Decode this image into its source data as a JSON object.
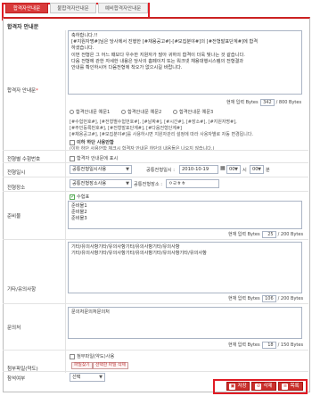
{
  "tabs": [
    {
      "label": "합격자안내문"
    },
    {
      "label": "불합격자안내문"
    },
    {
      "label": "예비합격자안내문"
    }
  ],
  "notice": {
    "section_title": "합격자 안내문",
    "label": "합격자 안내문",
    "required_mark": "*",
    "text_lines": [
      "축하합니다.!!",
      "[#지원자명#]님은 당사에서 진행한 [#채용공고#]-[#모집분야#]의 [#전형발표단계#]에 합격",
      "하셨습니다.",
      "이번 전형은 그 어느 때보다 우수한 지원자가 많아 귀하의 합격이 더욱 빛나는 것 같습니다.",
      "다음 전형에 관한 자세한 내용은 당사의 홈페이지 또는 워크넷 채용대행시스템의 전형결과",
      "안내를 확인하시어 다음전형에 착오가 없으시길 바랍니다."
    ],
    "bytes_label": "현재 입력 Bytes",
    "bytes_current": "342",
    "bytes_max": "/ 800 Bytes",
    "radio_options": [
      "합격안내문 예문1",
      "합격안내문 예문2",
      "합격안내문 예문3"
    ],
    "tags_line1": "[#수험번호#], [#전형별수험번호#], [#날짜#], [#시간#], [#장소#], [#지원자명#],",
    "tags_line2": "[#주민등록번호#], [#전형발표단계#], [#다음전형단계#]",
    "tags_line3": "[#채용공고#], [#모집분야#]를 사용하시면 지원자관리 설정에 따라 사용자별로 자동 변경됩니다.",
    "check_label": "이하 하단 사용안함",
    "check_note": "(이하 하단 사용안함 체크시 합격자 안내문 하단의 내용들은 나오지 않습니다.)"
  },
  "exam_number": {
    "label": "전형별 수험번호",
    "check_label": "합격자 안내문에 표시"
  },
  "schedule": {
    "label": "전형일시",
    "select_value": "공통전형일시사용",
    "date_label": "공통전형일시 :",
    "date_value": "2010-10-19",
    "hour_value": "00",
    "hour_unit": "시",
    "minute_value": "00",
    "minute_unit": "분"
  },
  "place": {
    "label": "전형장소",
    "select_value": "공통전형장소사용",
    "place_label": "공통전형장소 :",
    "place_value": "ㅇㄹㅎㅎ"
  },
  "supplies": {
    "label": "준비물",
    "check_label": "수험표",
    "lines": [
      "준비물1",
      "준비물2",
      "준비물3"
    ],
    "bytes_label": "현재 입력 Bytes",
    "bytes_current": "25",
    "bytes_max": "/ 200 Bytes"
  },
  "other": {
    "label": "기타/유의사항",
    "lines": [
      "기타/유의사항기타/유의사항기타/유의사항기타/유의사항",
      "기타/유의사항기타/유의사항기타/유의사항기타/유의사항기타/유의사항"
    ],
    "bytes_label": "현재 입력 Bytes",
    "bytes_current": "106",
    "bytes_max": "/ 200 Bytes"
  },
  "contact": {
    "label": "문의처",
    "lines": [
      "문의처문의처문의처"
    ],
    "bytes_label": "현재 입력 Bytes",
    "bytes_current": "18",
    "bytes_max": "/ 150 Bytes"
  },
  "attachment": {
    "label": "첨부파일(약도)",
    "check_label": "첨부파일(약도)사용",
    "btn_find": "파일찾기",
    "btn_delete": "선택한 파일 삭제"
  },
  "attendance": {
    "label": "참석여부",
    "select_value": "선택"
  },
  "actions": {
    "save": "저장",
    "delete": "삭제",
    "list": "목록"
  },
  "colors": {
    "accent": "#e01b24",
    "button": "#c9302c"
  }
}
